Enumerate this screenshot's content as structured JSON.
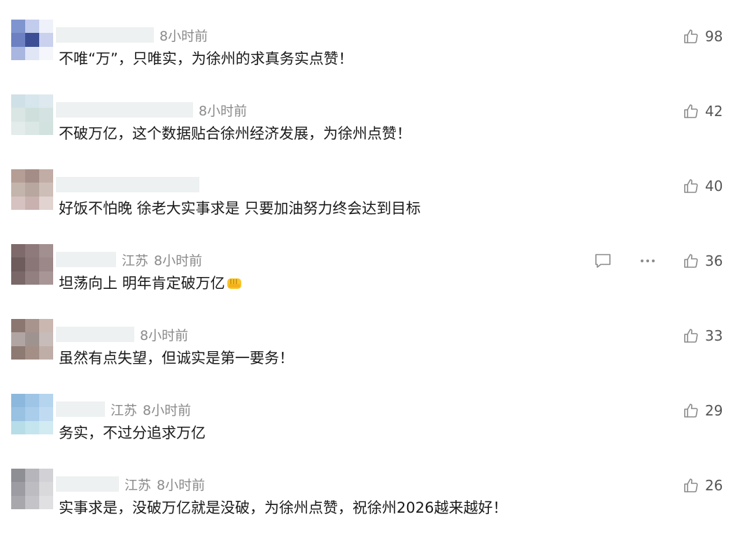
{
  "comments": [
    {
      "location": "",
      "time": "8小时前",
      "text": "不唯“万”，只唯实，为徐州的求真务实点赞！",
      "likes": "98",
      "avatar_colors": [
        "#7f95cf",
        "#c2ccec",
        "#eef1f9",
        "#6c80c2",
        "#3c4f96",
        "#c9d1ee",
        "#a9b6e0",
        "#e1e6f6",
        "#f5f6fb"
      ],
      "emoji": ""
    },
    {
      "location": "",
      "time": "8小时前",
      "text": "不破万亿，这个数据贴合徐州经济发展，为徐州点赞！",
      "likes": "42",
      "avatar_colors": [
        "#cfe0e6",
        "#d6e6ec",
        "#dde9ee",
        "#d9e6e3",
        "#cfe0dc",
        "#d4e3e1",
        "#e3ecea",
        "#dae7e4",
        "#d2e2df"
      ],
      "emoji": ""
    },
    {
      "location": "",
      "time": "",
      "text": "好饭不怕晚  徐老大实事求是 只要加油努力终会达到目标",
      "likes": "40",
      "avatar_colors": [
        "#b59e95",
        "#a58d87",
        "#c1ada5",
        "#c3b4ac",
        "#b7a79f",
        "#cdbeb8",
        "#d6c2c0",
        "#c9b1b0",
        "#e1d3d0"
      ],
      "emoji": ""
    },
    {
      "location": "江苏",
      "time": "8小时前",
      "text": "坦荡向上 明年肯定破万亿",
      "likes": "36",
      "avatar_colors": [
        "#7e6a6a",
        "#8e7a7a",
        "#a28f8f",
        "#6e5c5c",
        "#8a7676",
        "#9c8888",
        "#7a6868",
        "#928080",
        "#a89696"
      ],
      "emoji": "fist-bump",
      "has_reply": true,
      "has_more": true
    },
    {
      "location": "",
      "time": "8小时前",
      "text": "虽然有点失望，但诚实是第一要务！",
      "likes": "33",
      "avatar_colors": [
        "#8c7770",
        "#a8948c",
        "#c9b7b0",
        "#b0a5a2",
        "#9f9390",
        "#c7bcb9",
        "#8d7a72",
        "#a48f86",
        "#bfaea7"
      ],
      "emoji": ""
    },
    {
      "location": "江苏",
      "time": "8小时前",
      "text": "务实，不过分追求万亿",
      "likes": "29",
      "avatar_colors": [
        "#8db8dd",
        "#9fc5e6",
        "#b5d4ee",
        "#98c1e2",
        "#a9cdea",
        "#c0dbf1",
        "#b6dde8",
        "#c4e4ee",
        "#d2eaf2"
      ],
      "emoji": ""
    },
    {
      "location": "江苏",
      "time": "8小时前",
      "text": "实事求是，没破万亿就是没破，为徐州点赞，祝徐州2026越来越好！",
      "likes": "26",
      "avatar_colors": [
        "#8e8e95",
        "#b5b5bb",
        "#d2d2d6",
        "#9c9ca2",
        "#bcbcc1",
        "#d9d9dc",
        "#a7a7ac",
        "#c4c4c8",
        "#e0e0e3"
      ],
      "emoji": ""
    }
  ]
}
